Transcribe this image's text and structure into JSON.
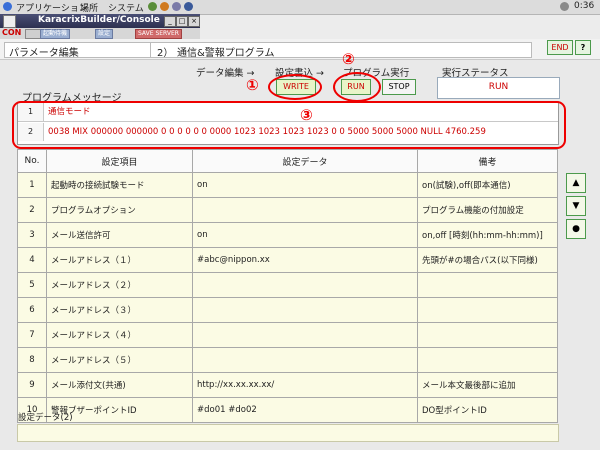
{
  "top_panel": {
    "menus": [
      "アプリケーション",
      "場所",
      "システム"
    ],
    "clock": "0:36"
  },
  "window": {
    "title": "KaracrixBuilder/Console",
    "con_tag": "CON",
    "toolbar_tags": [
      "起動待機",
      "設定",
      "SAVE SERVER"
    ]
  },
  "header": {
    "section": "パラメータ編集",
    "title_num": "2）",
    "title": "通信&警報プログラム",
    "end_label": "END",
    "help_label": "?"
  },
  "controls": {
    "data_edit_label": "データ編集 →",
    "settings_write_label": "設定書込 →",
    "program_exec_label": "プログラム実行",
    "exec_status_label": "実行ステータス",
    "write_btn": "WRITE",
    "run_btn": "RUN",
    "stop_btn": "STOP",
    "status_value": "RUN"
  },
  "annotations": {
    "one": "①",
    "two": "②",
    "three": "③"
  },
  "program_message": {
    "label": "プログラムメッセージ",
    "rows": [
      {
        "num": "1",
        "text": "通信モード"
      },
      {
        "num": "2",
        "text": "0038 MIX 000000 000000 0 0 0 0 0 0 0000 1023 1023 1023 1023 0 0 5000 5000 5000 NULL 4760.259"
      }
    ]
  },
  "table": {
    "headers": [
      "No.",
      "設定項目",
      "設定データ",
      "備考"
    ],
    "rows": [
      {
        "no": "1",
        "item": "起動時の接続試験モード",
        "data": "on",
        "note": "on(試験),off(即本通信)"
      },
      {
        "no": "2",
        "item": "プログラムオプション",
        "data": "",
        "note": "プログラム機能の付加設定"
      },
      {
        "no": "3",
        "item": "メール送信許可",
        "data": "on",
        "note": "on,off [時刻(hh:mm-hh:mm)]"
      },
      {
        "no": "4",
        "item": "メールアドレス（１）",
        "data": "#abc@nippon.xx",
        "note": "先頭が#の場合パス(以下同様)"
      },
      {
        "no": "5",
        "item": "メールアドレス（２）",
        "data": "",
        "note": ""
      },
      {
        "no": "6",
        "item": "メールアドレス（３）",
        "data": "",
        "note": ""
      },
      {
        "no": "7",
        "item": "メールアドレス（４）",
        "data": "",
        "note": ""
      },
      {
        "no": "8",
        "item": "メールアドレス（５）",
        "data": "",
        "note": ""
      },
      {
        "no": "9",
        "item": "メール添付文(共通)",
        "data": "http://xx.xx.xx.xx/",
        "note": "メール本文最後部に追加"
      },
      {
        "no": "10",
        "item": "警報ブザーポイントID",
        "data": "#do01 #do02",
        "note": "DO型ポイントID"
      }
    ]
  },
  "side_buttons": [
    "▲",
    "▼",
    "●"
  ],
  "footer": {
    "label": "設定データ(2)",
    "value": ""
  },
  "colors": {
    "accent_red": "#e00000",
    "button_green": "#4c9a4c",
    "table_cell": "#fbfbe4"
  }
}
